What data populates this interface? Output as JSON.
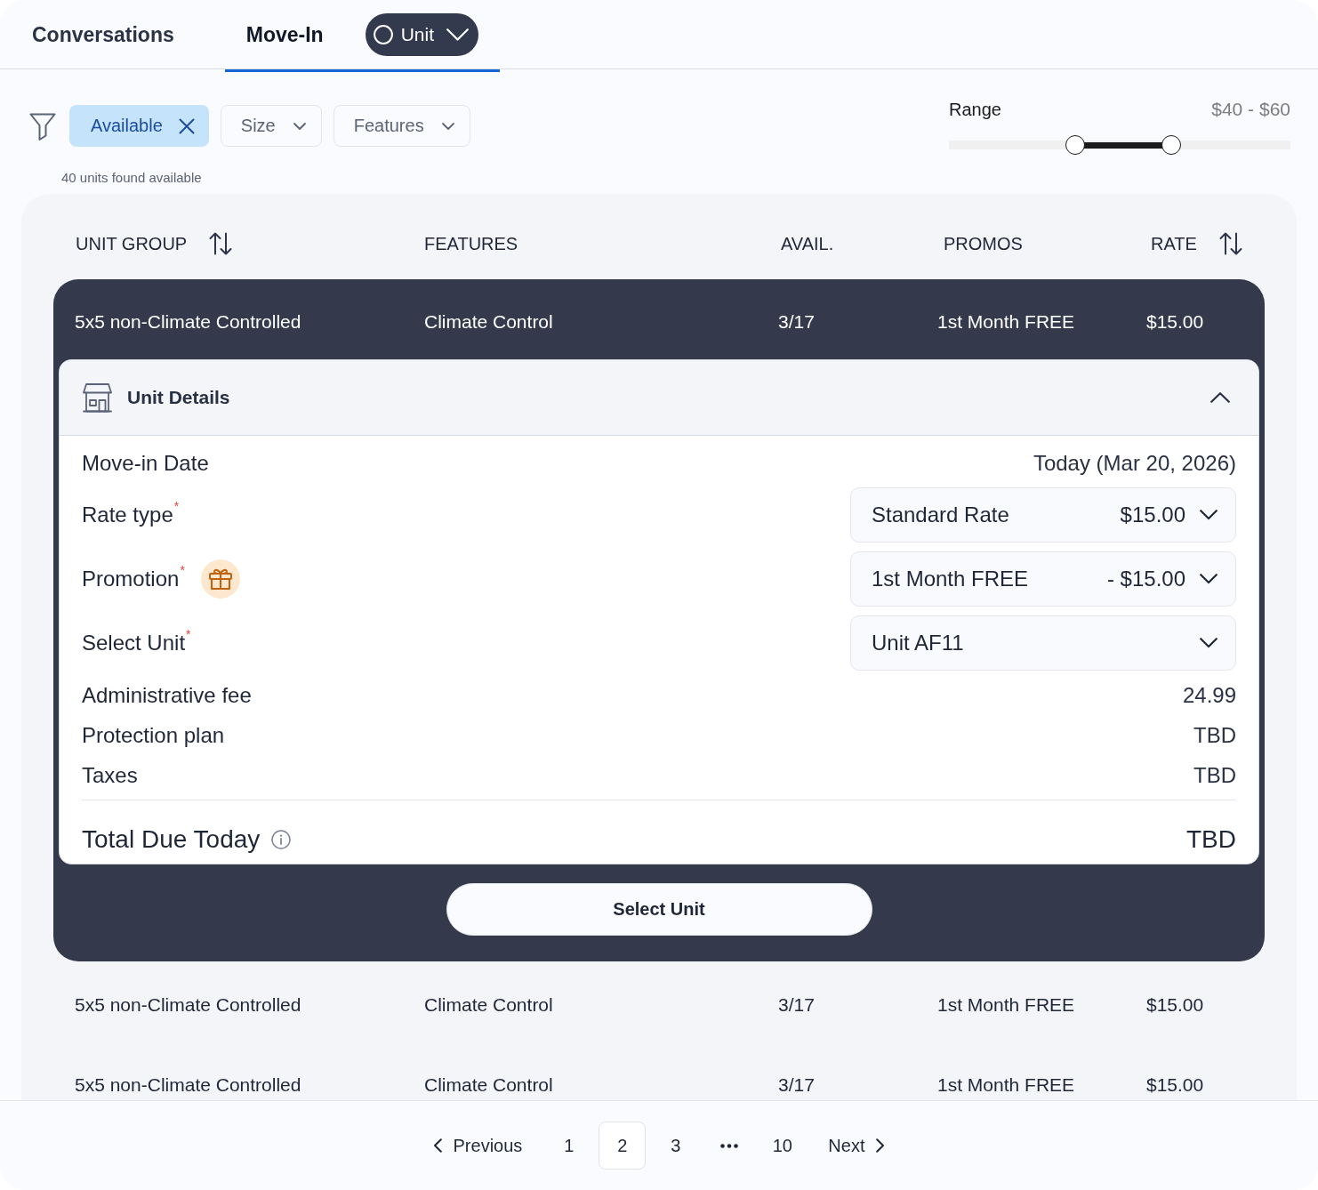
{
  "tabs": [
    {
      "label": "Conversations",
      "selected": false
    },
    {
      "label": "Move-In",
      "selected": true,
      "dropdown": {
        "label": "Unit"
      }
    }
  ],
  "filters": [
    {
      "label": "Available",
      "selected": true
    },
    {
      "label": "Size",
      "selected": false
    },
    {
      "label": "Features",
      "selected": false
    }
  ],
  "results_count": "40 units found available",
  "range": {
    "label": "Range",
    "value": "$40 - $60",
    "thumbs": [
      {
        "level": 0.37
      },
      {
        "level": 0.65
      }
    ]
  },
  "table": {
    "columns": [
      {
        "label": "UNIT GROUP",
        "sortable": true
      },
      {
        "label": "FEATURES",
        "sortable": false
      },
      {
        "label": "AVAIL.",
        "sortable": false
      },
      {
        "label": "PROMOS",
        "sortable": false
      },
      {
        "label": "RATE",
        "sortable": true
      }
    ],
    "rows": [
      {
        "cells": [
          "5x5 non-Climate Controlled",
          "Climate Control",
          "3/17",
          "1st Month FREE",
          "$15.00"
        ],
        "expanded": true,
        "details": {
          "title": "Unit Details",
          "fields": [
            {
              "kind": "value",
              "label": "Move-in Date",
              "value": "Today (Mar 20, 2026)"
            },
            {
              "kind": "select",
              "label": "Rate type$^{*}$",
              "value": "Standard Rate",
              "amount": "$15.00"
            },
            {
              "kind": "promo",
              "label": "Promotion$^{*}$",
              "value": "1st Month FREE",
              "amount": "- $15.00"
            },
            {
              "kind": "select",
              "label": "Select Unit$^{*}$",
              "value": "Unit AF11"
            },
            {
              "kind": "value",
              "label": "Administrative fee",
              "value": "24.99"
            },
            {
              "kind": "value",
              "label": "Protection plan",
              "value": "TBD"
            },
            {
              "kind": "value",
              "label": "Taxes",
              "value": "TBD"
            }
          ],
          "total": {
            "label": "Total Due Today",
            "value": "TBD"
          },
          "action": "Select Unit"
        }
      },
      {
        "cells": [
          "5x5 non-Climate Controlled",
          "Climate Control",
          "3/17",
          "1st Month FREE",
          "$15.00"
        ],
        "expanded": false
      },
      {
        "cells": [
          "5x5 non-Climate Controlled",
          "Climate Control",
          "3/17",
          "1st Month FREE",
          "$15.00"
        ],
        "expanded": false
      }
    ]
  },
  "pagination": {
    "previous": "Previous",
    "pages": [
      {
        "kind": "page",
        "label": "1",
        "selected": false
      },
      {
        "kind": "page",
        "label": "2",
        "selected": true
      },
      {
        "kind": "page",
        "label": "3",
        "selected": false
      },
      {
        "kind": "ellipsis"
      },
      {
        "kind": "page",
        "label": "10",
        "selected": false
      }
    ],
    "next": "Next"
  }
}
